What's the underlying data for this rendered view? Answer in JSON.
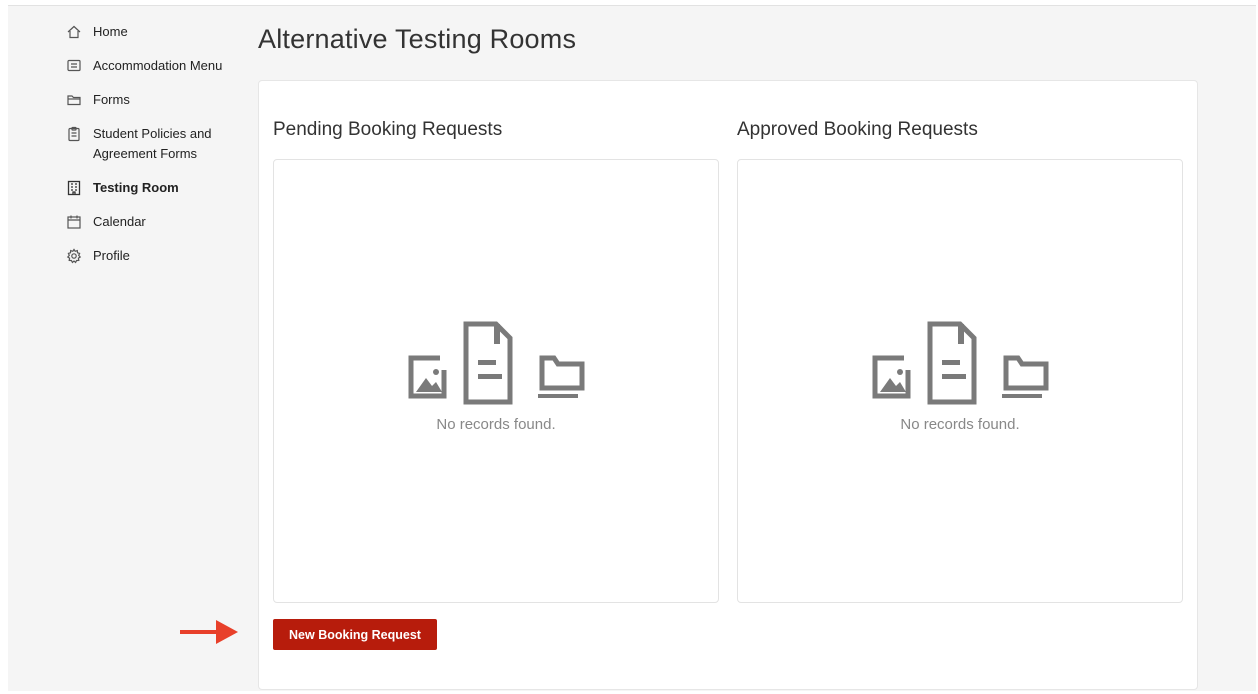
{
  "sidebar": {
    "items": [
      {
        "label": "Home",
        "icon": "home-icon"
      },
      {
        "label": "Accommodation Menu",
        "icon": "message-icon"
      },
      {
        "label": "Forms",
        "icon": "folder-icon"
      },
      {
        "label": "Student Policies and Agreement Forms",
        "icon": "clipboard-icon"
      },
      {
        "label": "Testing Room",
        "icon": "building-icon",
        "active": true
      },
      {
        "label": "Calendar",
        "icon": "calendar-icon"
      },
      {
        "label": "Profile",
        "icon": "gear-icon"
      }
    ]
  },
  "main": {
    "title": "Alternative Testing Rooms",
    "pending": {
      "title": "Pending Booking Requests",
      "empty_text": "No records found."
    },
    "approved": {
      "title": "Approved Booking Requests",
      "empty_text": "No records found."
    },
    "new_button_label": "New Booking Request"
  },
  "colors": {
    "accent": "#b71c0c",
    "arrow": "#e8402a",
    "empty_icon": "#7a7a7a"
  }
}
